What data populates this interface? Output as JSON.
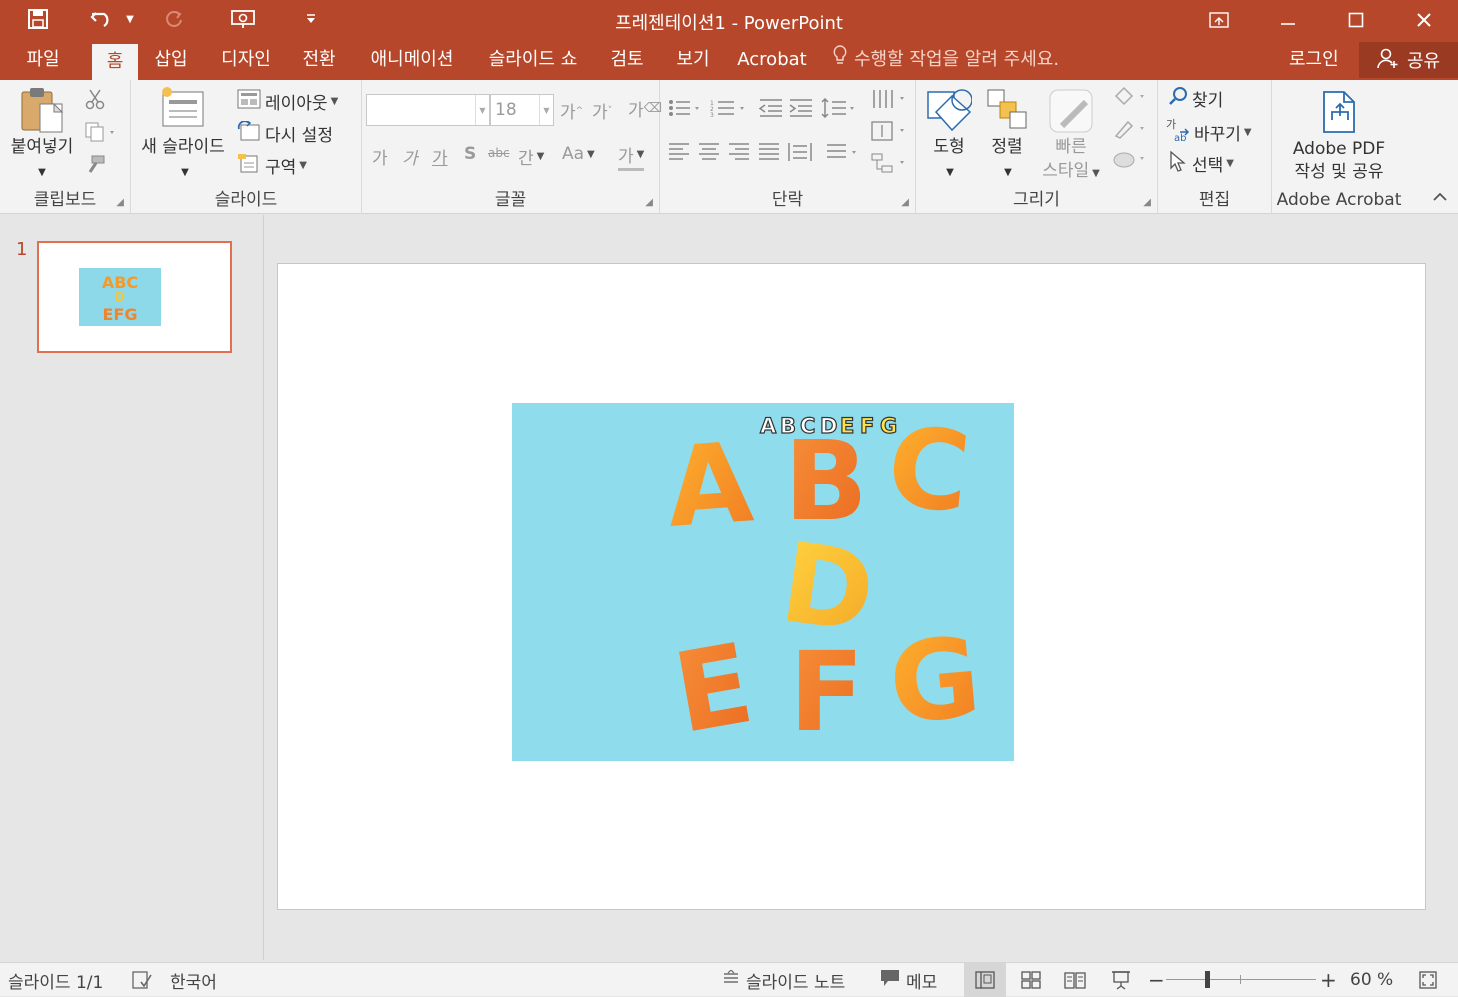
{
  "window": {
    "title": "프레젠테이션1 - PowerPoint",
    "accent_color": "#b7472a"
  },
  "quick_access": {
    "icons": [
      "save-icon",
      "undo-icon",
      "undo-dropdown-icon",
      "redo-icon",
      "start-from-beginning-icon",
      "customize-qat-icon"
    ]
  },
  "tabs": {
    "file": "파일",
    "home": "홈",
    "insert": "삽입",
    "design": "디자인",
    "transitions": "전환",
    "animations": "애니메이션",
    "slideshow": "슬라이드 쇼",
    "review": "검토",
    "view": "보기",
    "acrobat": "Acrobat",
    "active": "홈"
  },
  "tell_me": {
    "placeholder": "수행할 작업을 알려 주세요."
  },
  "account": {
    "login": "로그인",
    "share": "공유"
  },
  "ribbon": {
    "clipboard": {
      "label": "클립보드",
      "paste": "붙여넣기"
    },
    "slides": {
      "label": "슬라이드",
      "new_slide": "새 슬라이드",
      "layout": "레이아웃",
      "reset": "다시 설정",
      "section": "구역"
    },
    "font": {
      "label": "글꼴",
      "font_name": "",
      "font_size": "18",
      "grow_font": "가",
      "shrink_font": "가",
      "clear_format": "가",
      "bold": "가",
      "italic": "가",
      "underline": "가",
      "shadow": "S",
      "strikethrough": "abc",
      "spacing": "간",
      "change_case": "Aa",
      "font_color": "가"
    },
    "paragraph": {
      "label": "단락"
    },
    "drawing": {
      "label": "그리기",
      "shapes": "도형",
      "arrange": "정렬",
      "quick_styles_line1": "빠른",
      "quick_styles_line2": "스타일"
    },
    "editing": {
      "label": "편집",
      "find": "찾기",
      "replace": "바꾸기",
      "select": "선택"
    },
    "acrobat": {
      "label": "Adobe Acrobat",
      "create_line1": "Adobe PDF",
      "create_line2": "작성 및 공유"
    }
  },
  "slide_panel": {
    "slide_number": "1"
  },
  "slide": {
    "picture_small_row": [
      "A",
      "B",
      "C",
      "D",
      "E",
      "F",
      "G"
    ],
    "picture_big_row1": [
      "A",
      "B",
      "C"
    ],
    "picture_big_row2": [
      "D"
    ],
    "picture_big_row3": [
      "E",
      "F",
      "G"
    ],
    "thumb_row1": "ABC",
    "thumb_row3": "EFG"
  },
  "statusbar": {
    "slide_counter": "슬라이드 1/1",
    "language": "한국어",
    "notes": "슬라이드 노트",
    "comments": "메모",
    "zoom": "60 %",
    "zoom_fraction": 0.6
  }
}
